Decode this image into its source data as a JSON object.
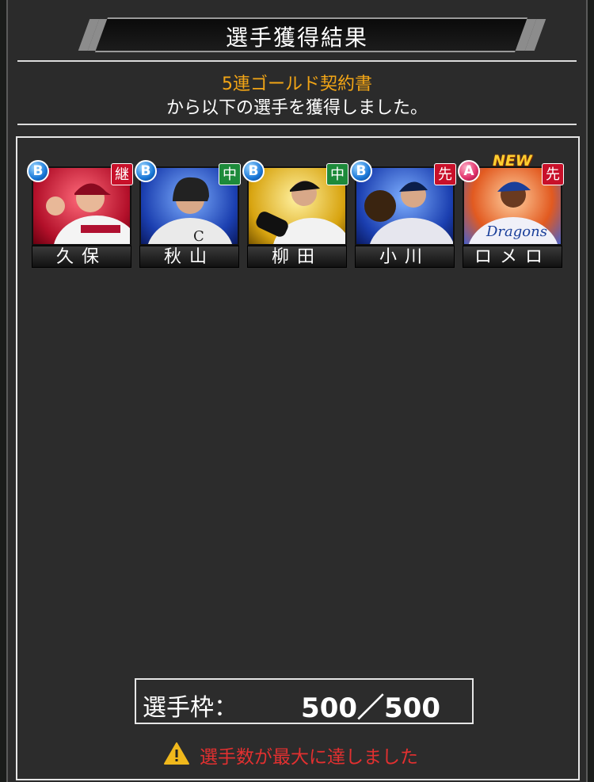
{
  "header": {
    "title": "選手獲得結果"
  },
  "message": {
    "item_name": "5連ゴールド契約書",
    "description": "から以下の選手を獲得しました。"
  },
  "players": [
    {
      "name": "久保",
      "rank": "B",
      "position": "継",
      "position_color": "#c8102a",
      "card_bg": "red",
      "is_new": false
    },
    {
      "name": "秋山",
      "rank": "B",
      "position": "中",
      "position_color": "#1d8a3a",
      "card_bg": "blue",
      "is_new": false
    },
    {
      "name": "柳田",
      "rank": "B",
      "position": "中",
      "position_color": "#1d8a3a",
      "card_bg": "gold",
      "is_new": false
    },
    {
      "name": "小川",
      "rank": "B",
      "position": "先",
      "position_color": "#c8102a",
      "card_bg": "blue",
      "is_new": false
    },
    {
      "name": "ロメロ",
      "rank": "A",
      "position": "先",
      "position_color": "#c8102a",
      "card_bg": "fire",
      "is_new": true,
      "new_label": "NEW"
    }
  ],
  "slots": {
    "label": "選手枠：",
    "value": "500／500"
  },
  "warning": {
    "icon": "warning-triangle-icon",
    "text": "選手数が最大に達しました"
  }
}
